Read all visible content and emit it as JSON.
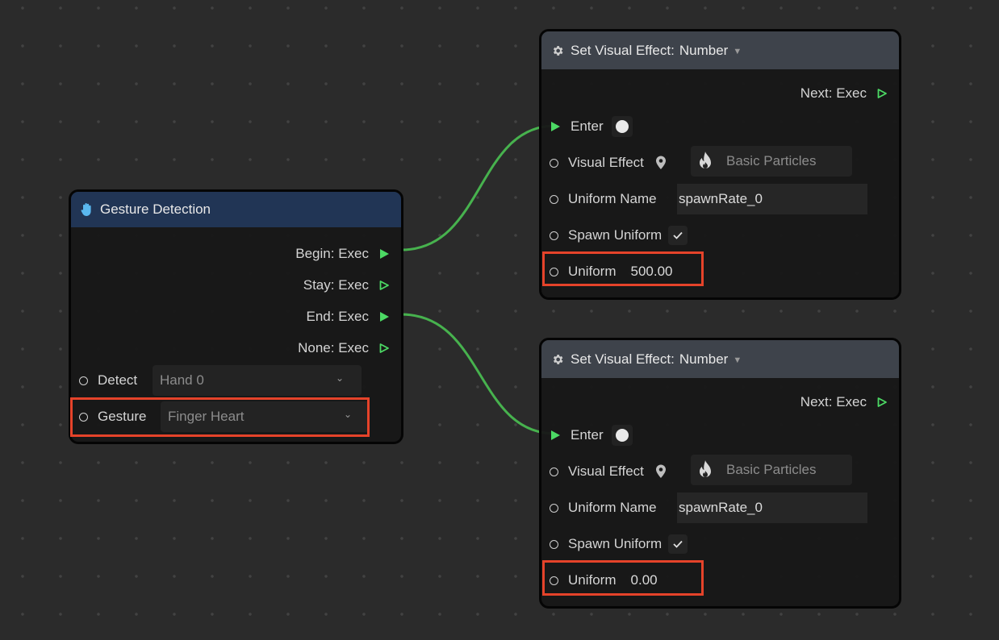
{
  "canvas": {
    "background": "#2b2b2b",
    "wire_color": "#4caf50",
    "exec_color": "#4cd964",
    "highlight_color": "#e5432a"
  },
  "nodes": {
    "gesture_detection": {
      "icon": "hand-icon",
      "title": "Gesture Detection",
      "header_color": "#213555",
      "outputs": [
        {
          "label": "Begin: Exec",
          "connected": true
        },
        {
          "label": "Stay: Exec",
          "connected": false
        },
        {
          "label": "End: Exec",
          "connected": true
        },
        {
          "label": "None: Exec",
          "connected": false
        }
      ],
      "inputs": {
        "detect": {
          "label": "Detect",
          "value": "Hand 0"
        },
        "gesture": {
          "label": "Gesture",
          "value": "Finger Heart",
          "highlighted": true
        }
      }
    },
    "set_vfx_top": {
      "icon": "gear-icon",
      "title": "Set Visual Effect:",
      "type_value": "Number",
      "header_color": "#3e434b",
      "next_label": "Next: Exec",
      "enter_label": "Enter",
      "visual_effect": {
        "label": "Visual Effect",
        "value": "Basic Particles",
        "icon": "fire-icon"
      },
      "uniform_name": {
        "label": "Uniform Name",
        "value": "spawnRate_0"
      },
      "spawn_uniform": {
        "label": "Spawn Uniform",
        "checked": true
      },
      "uniform": {
        "label": "Uniform",
        "value": "500.00",
        "highlighted": true
      }
    },
    "set_vfx_bottom": {
      "icon": "gear-icon",
      "title": "Set Visual Effect:",
      "type_value": "Number",
      "header_color": "#3e434b",
      "next_label": "Next: Exec",
      "enter_label": "Enter",
      "visual_effect": {
        "label": "Visual Effect",
        "value": "Basic Particles",
        "icon": "fire-icon"
      },
      "uniform_name": {
        "label": "Uniform Name",
        "value": "spawnRate_0"
      },
      "spawn_uniform": {
        "label": "Spawn Uniform",
        "checked": true
      },
      "uniform": {
        "label": "Uniform",
        "value": "0.00",
        "highlighted": true
      }
    }
  },
  "connections": [
    {
      "from": "gesture_detection.Begin",
      "to": "set_vfx_top.Enter"
    },
    {
      "from": "gesture_detection.End",
      "to": "set_vfx_bottom.Enter"
    }
  ]
}
